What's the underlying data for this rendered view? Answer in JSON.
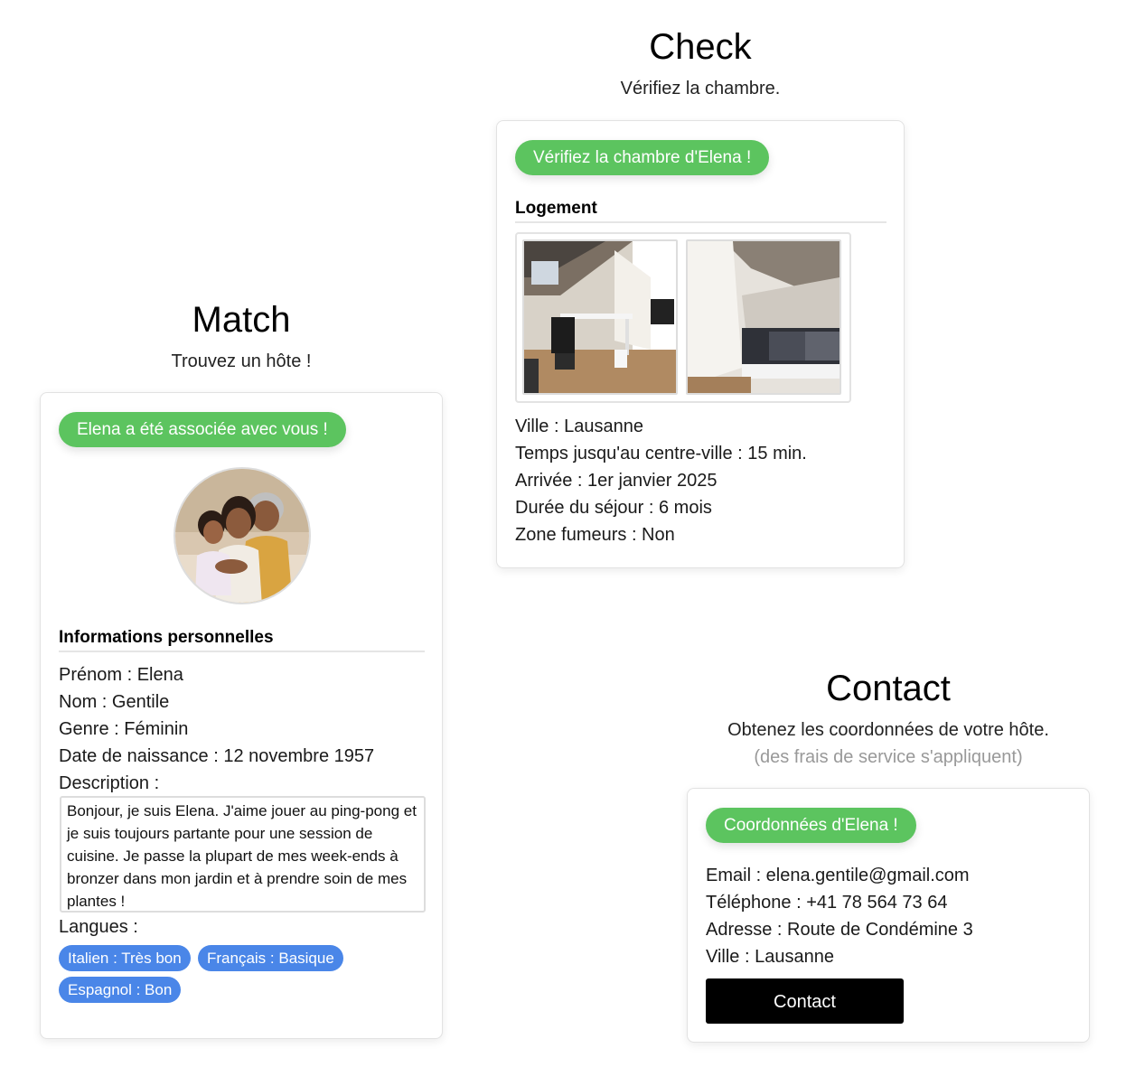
{
  "match": {
    "title": "Match",
    "subtitle": "Trouvez un hôte !",
    "badge": "Elena a été associée avec vous !",
    "avatar_icon": "family-photo",
    "section_heading": "Informations personnelles",
    "lines": [
      "Prénom : Elena",
      "Nom : Gentile",
      "Genre : Féminin",
      "Date de naissance : 12 novembre 1957",
      "Description :"
    ],
    "description": "Bonjour, je suis Elena. J'aime jouer au ping-pong et je suis toujours partante pour une session de cuisine. Je passe la plupart de mes week-ends à bronzer dans mon jardin et à prendre soin de mes plantes !",
    "languages_label": "Langues :",
    "languages": [
      "Italien : Très bon",
      "Français : Basique",
      "Espagnol : Bon"
    ]
  },
  "check": {
    "title": "Check",
    "subtitle": "Vérifiez la chambre.",
    "badge": "Vérifiez la chambre d'Elena !",
    "section_heading": "Logement",
    "photo_icons": [
      "room-desk-photo",
      "room-bed-photo"
    ],
    "lines": [
      "Ville : Lausanne",
      "Temps jusqu'au centre-ville : 15 min.",
      "Arrivée : 1er janvier 2025",
      "Durée du séjour : 6 mois",
      "Zone fumeurs : Non"
    ]
  },
  "contact": {
    "title": "Contact",
    "subtitle": "Obtenez les coordonnées de votre hôte.",
    "note": "(des frais de service s'appliquent)",
    "badge": "Coordonnées d'Elena !",
    "lines": [
      "Email : elena.gentile@gmail.com",
      "Téléphone : +41 78 564 73 64",
      "Adresse : Route de Condémine 3",
      "Ville : Lausanne"
    ],
    "button_label": "Contact"
  },
  "colors": {
    "green_badge": "#5cc45f",
    "blue_pill": "#4a86e8",
    "button_black": "#000000"
  }
}
